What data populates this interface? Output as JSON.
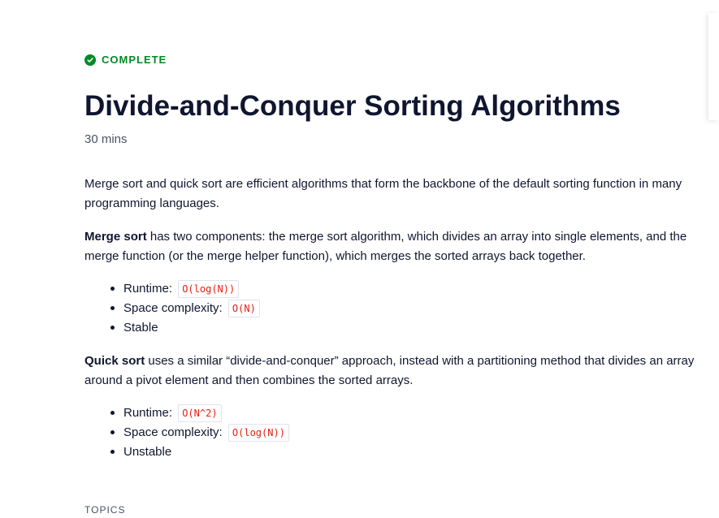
{
  "status": {
    "label": "COMPLETE",
    "icon": "check-circle-icon",
    "color": "#008a27"
  },
  "lesson": {
    "title": "Divide-and-Conquer Sorting Algorithms",
    "duration": "30 mins"
  },
  "body": {
    "intro": "Merge sort and quick sort are efficient algorithms that form the backbone of the default sorting function in many programming languages.",
    "merge_sort": {
      "term": "Merge sort",
      "description": " has two components: the merge sort algorithm, which divides an array into single elements, and the merge function (or the merge helper function), which merges the sorted arrays back together.",
      "bullets": [
        {
          "label": "Runtime: ",
          "code": "O(log(N))"
        },
        {
          "label": "Space complexity: ",
          "code": "O(N)"
        },
        {
          "label": "Stable",
          "code": ""
        }
      ]
    },
    "quick_sort": {
      "term": "Quick sort",
      "description": " uses a similar “divide-and-conquer” approach, instead with a partitioning method that divides an array around a pivot element and then combines the sorted arrays.",
      "bullets": [
        {
          "label": "Runtime: ",
          "code": "O(N^2)"
        },
        {
          "label": "Space complexity: ",
          "code": "O(log(N))"
        },
        {
          "label": "Unstable",
          "code": ""
        }
      ]
    }
  },
  "topics": {
    "heading": "TOPICS"
  },
  "colors": {
    "accent_green": "#008a27",
    "code_red": "#e91c11",
    "text_dark": "#10162f",
    "text_muted": "#4b5265"
  }
}
